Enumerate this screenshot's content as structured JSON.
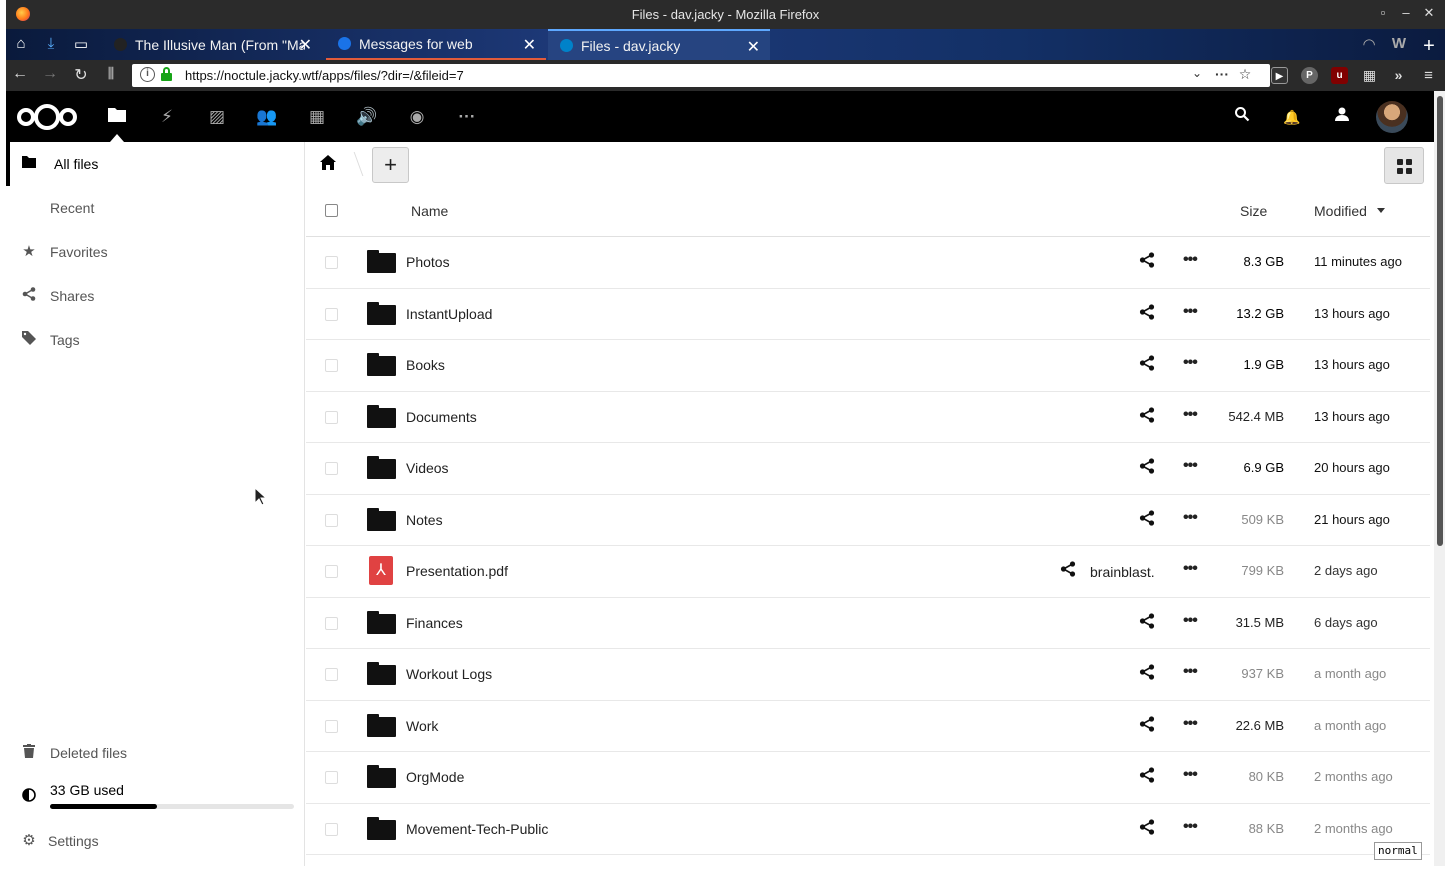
{
  "window": {
    "title": "Files - dav.jacky - Mozilla Firefox",
    "controls": [
      "▫",
      "–",
      "✕"
    ]
  },
  "tabs": [
    {
      "label": "The Illusive Man (From \"Mass",
      "icon_color": "#222222"
    },
    {
      "label": "Messages for web",
      "icon_color": "#1a73e8"
    },
    {
      "label": "Files - dav.jacky",
      "icon_color": "#0082c9"
    }
  ],
  "navbar": {
    "url": "https://noctule.jacky.wtf/apps/files/?dir=/&fileid=7"
  },
  "header": {
    "apps": [
      "files-icon",
      "activity-icon",
      "gallery-icon",
      "contacts-icon",
      "calendar-icon",
      "audio-icon",
      "maps-icon",
      "more-apps-icon"
    ]
  },
  "sidebar": {
    "items": [
      {
        "label": "All files",
        "icon": "folder-icon"
      },
      {
        "label": "Recent",
        "icon": "clock-icon"
      },
      {
        "label": "Favorites",
        "icon": "star-icon"
      },
      {
        "label": "Shares",
        "icon": "share-icon"
      },
      {
        "label": "Tags",
        "icon": "tag-icon"
      }
    ],
    "deleted_label": "Deleted files",
    "quota_label": "33 GB used",
    "quota_fraction": 0.44,
    "settings_label": "Settings"
  },
  "table": {
    "col_name": "Name",
    "col_size": "Size",
    "col_modified": "Modified",
    "rows": [
      {
        "name": "Photos",
        "type": "folder",
        "size": "8.3 GB",
        "modified": "11 minutes ago"
      },
      {
        "name": "InstantUpload",
        "type": "folder",
        "size": "13.2 GB",
        "modified": "13 hours ago"
      },
      {
        "name": "Books",
        "type": "folder",
        "size": "1.9 GB",
        "modified": "13 hours ago"
      },
      {
        "name": "Documents",
        "type": "folder",
        "size": "542.4 MB",
        "modified": "13 hours ago"
      },
      {
        "name": "Videos",
        "type": "folder",
        "size": "6.9 GB",
        "modified": "20 hours ago"
      },
      {
        "name": "Notes",
        "type": "folder",
        "size": "509 KB",
        "modified": "21 hours ago"
      },
      {
        "name": "Presentation.pdf",
        "type": "pdf",
        "size": "799 KB",
        "modified": "2 days ago",
        "sharee": "brainblast."
      },
      {
        "name": "Finances",
        "type": "folder",
        "size": "31.5 MB",
        "modified": "6 days ago"
      },
      {
        "name": "Workout Logs",
        "type": "folder",
        "size": "937 KB",
        "modified": "a month ago"
      },
      {
        "name": "Work",
        "type": "folder",
        "size": "22.6 MB",
        "modified": "a month ago"
      },
      {
        "name": "OrgMode",
        "type": "folder",
        "size": "80 KB",
        "modified": "2 months ago"
      },
      {
        "name": "Movement-Tech-Public",
        "type": "folder",
        "size": "88 KB",
        "modified": "2 months ago"
      }
    ]
  },
  "status_tip": "normal"
}
